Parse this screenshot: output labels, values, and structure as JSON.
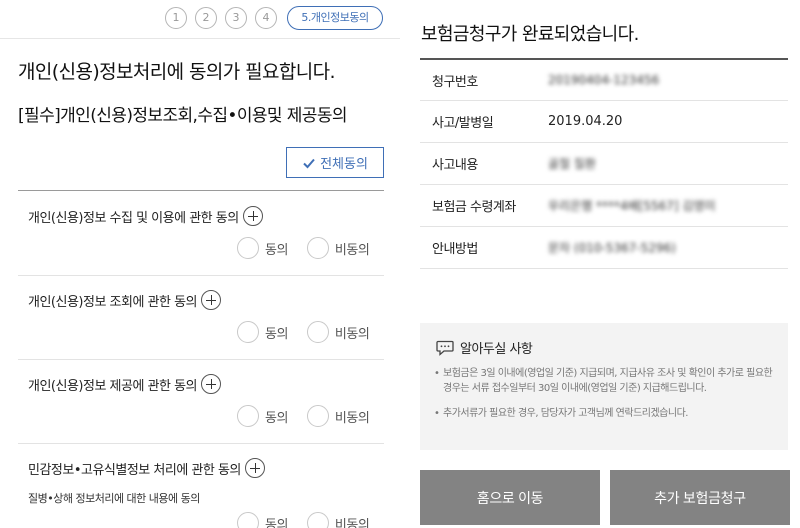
{
  "consent_page": {
    "steps": [
      "1",
      "2",
      "3",
      "4"
    ],
    "active_step": "5.개인정보동의",
    "title": "개인(신용)정보처리에 동의가 필요합니다.",
    "subtitle": "[필수]개인(신용)정보조회,수집•이용및 제공동의",
    "agree_all": "전체동의",
    "items": [
      {
        "title": "개인(신용)정보 수집 및 이용에 관한 동의",
        "agree": "동의",
        "disagree": "비동의"
      },
      {
        "title": "개인(신용)정보 조회에 관한 동의",
        "agree": "동의",
        "disagree": "비동의"
      },
      {
        "title": "개인(신용)정보 제공에 관한 동의",
        "agree": "동의",
        "disagree": "비동의"
      },
      {
        "title": "민감정보•고유식별정보 처리에 관한 동의",
        "subtext": "질병•상해 정보처리에 대한 내용에 동의",
        "agree": "동의",
        "disagree": "비동의"
      }
    ]
  },
  "complete_page": {
    "title": "보험금청구가 완료되었습니다.",
    "rows": [
      {
        "label": "청구번호",
        "value": "20190404-123456",
        "blurred": true
      },
      {
        "label": "사고/발병일",
        "value": "2019.04.20",
        "blurred": false
      },
      {
        "label": "사고내용",
        "value": "골절 질환",
        "blurred": true
      },
      {
        "label": "보험금 수령계좌",
        "value": "우리은행 ****4배[5567] 김영미",
        "blurred": true
      },
      {
        "label": "안내방법",
        "value": "문자 (010-5367-5296)",
        "blurred": true
      }
    ],
    "notice": {
      "heading": "알아두실 사항",
      "items": [
        "보험금은 3일 이내에(영업일 기준) 지급되며, 지급사유 조사 및 확인이 추가로 필요한 경우는 서류 접수일부터 30일 이내에(영업일 기준) 지급해드립니다.",
        "추가서류가 필요한 경우, 담당자가 고객님께 연락드리겠습니다."
      ]
    },
    "buttons": {
      "home": "홈으로 이동",
      "additional": "추가 보험금청구"
    }
  },
  "colors": {
    "accent": "#3f6fb6",
    "button_bg": "#838383",
    "notice_bg": "#f3f3f3"
  }
}
